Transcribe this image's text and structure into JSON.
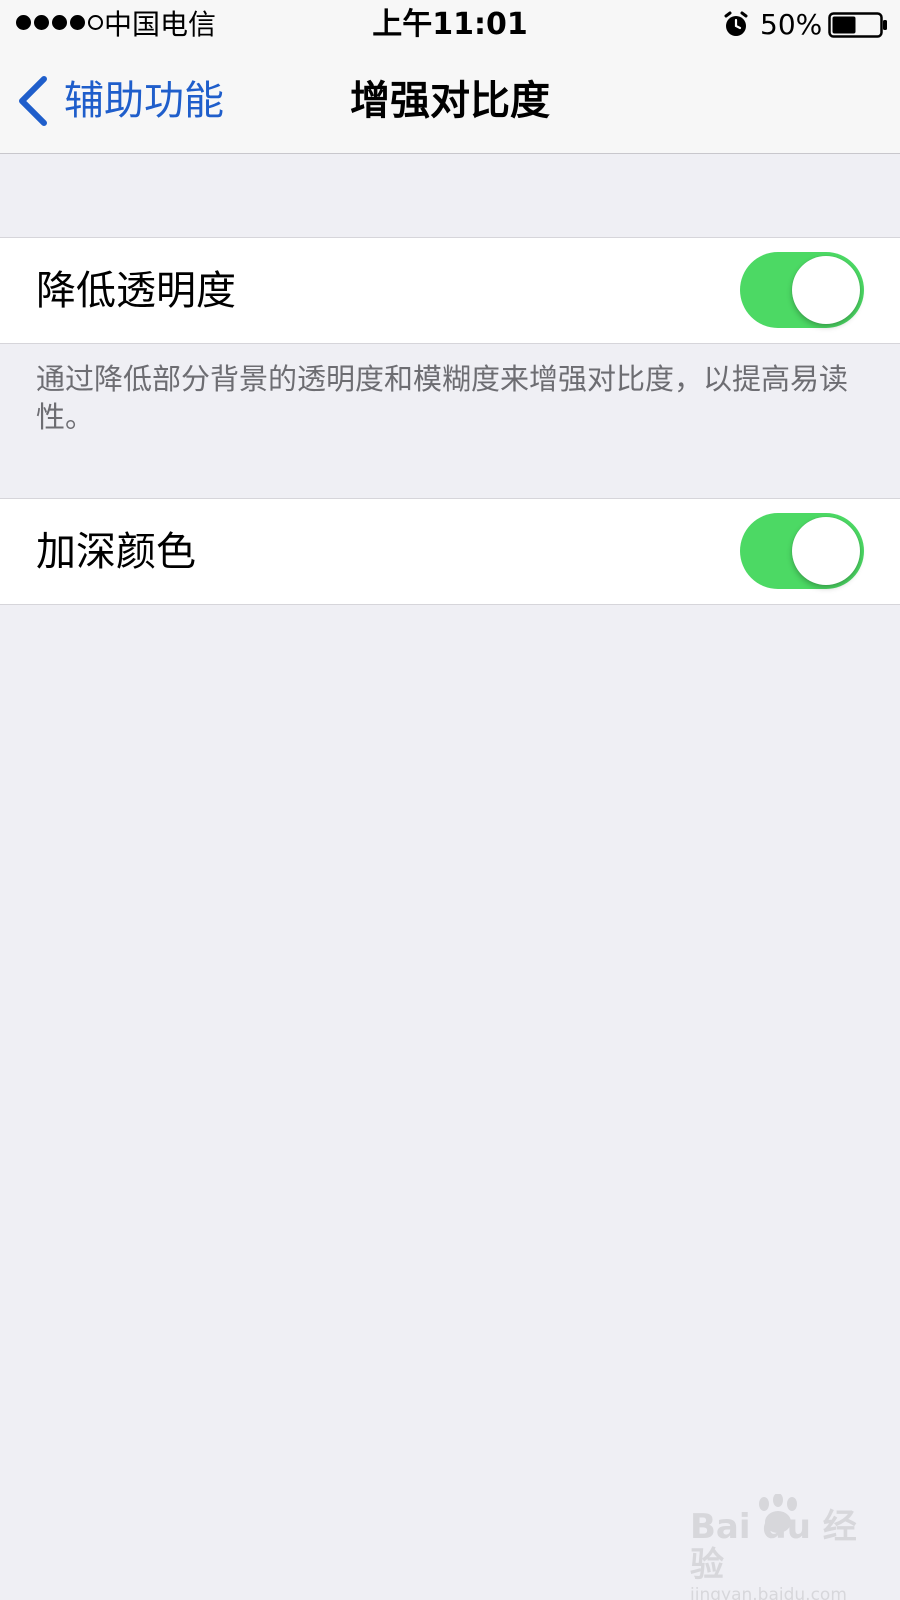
{
  "status_bar": {
    "signal_dots": [
      true,
      true,
      true,
      true,
      false
    ],
    "carrier": "中国电信",
    "time": "上午11:01",
    "alarm_icon": "alarm-clock-icon",
    "battery_percent": "50%",
    "battery_level": 0.5
  },
  "nav": {
    "back_label": "辅助功能",
    "back_icon": "chevron-left-icon",
    "title": "增强对比度"
  },
  "settings": [
    {
      "label": "降低透明度",
      "enabled": true
    },
    {
      "label": "加深颜色",
      "enabled": true
    }
  ],
  "footer_note": "通过降低部分背景的透明度和模糊度来增强对比度，以提高易读性。",
  "watermark": {
    "logo": "Bai du 经验",
    "url": "jingyan.baidu.com"
  },
  "colors": {
    "accent": "#1f5ecb",
    "toggle_on": "#4cd964",
    "background": "#efeff4",
    "bar_background": "#f7f7f7"
  }
}
